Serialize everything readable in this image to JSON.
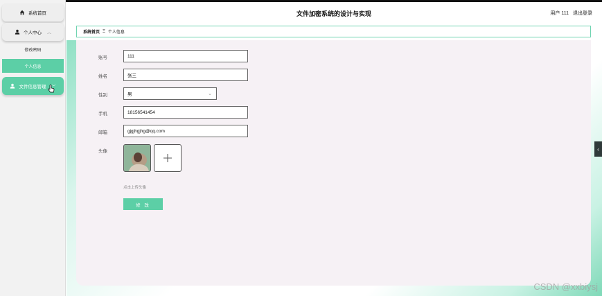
{
  "header": {
    "title": "文件加密系统的设计与实现",
    "user_text": "用户 111",
    "logout_label": "退出登录"
  },
  "sidebar": {
    "home_label": "系统首页",
    "personal_center_label": "个人中心",
    "sub_items": [
      "修改密码",
      "个人信息"
    ],
    "file_manage_label": "文件信息管理"
  },
  "breadcrumb": {
    "home": "系统首页",
    "separator": "Ξ",
    "current": "个人信息"
  },
  "form": {
    "account_label": "账号",
    "account_value": "111",
    "name_label": "姓名",
    "name_value": "张三",
    "gender_label": "性别",
    "gender_value": "男",
    "phone_label": "手机",
    "phone_value": "18156541454",
    "email_label": "邮箱",
    "email_value": "gjgjhgjhg@qq.com",
    "avatar_label": "头像",
    "upload_hint": "点击上传头像",
    "submit_label": "修 改"
  },
  "colors": {
    "accent": "#5ccfa6",
    "card_bg": "#f6f1f5",
    "topbar_border": "#111111"
  },
  "watermark": "CSDN @xxbiysj"
}
